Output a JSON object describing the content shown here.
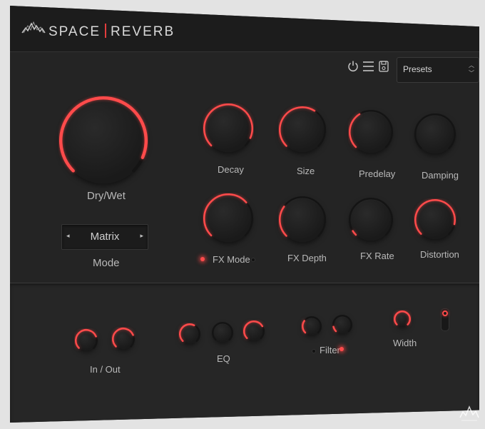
{
  "brand": {
    "left": "SPACE",
    "right": "REVERB",
    "logo_icon": "waveform-logo-icon"
  },
  "toolbar": {
    "power_icon": "power-icon",
    "menu_icon": "menu-icon",
    "save_icon": "save-icon",
    "presets_label": "Presets",
    "presets_arrow_up": "^",
    "presets_arrow_down": "v"
  },
  "colors": {
    "accent": "#ff4b4b",
    "panel": "#242424",
    "header": "#1c1c1c"
  },
  "main_knobs": {
    "dry_wet": {
      "label": "Dry/Wet",
      "value": 0.92
    },
    "decay": {
      "label": "Decay",
      "value": 0.92
    },
    "size": {
      "label": "Size",
      "value": 0.62
    },
    "predelay": {
      "label": "Predelay",
      "value": 0.38
    },
    "damping": {
      "label": "Damping",
      "value": 0.0
    },
    "fx_mode": {
      "label": "FX Mode",
      "value": 0.68
    },
    "fx_depth": {
      "label": "FX Depth",
      "value": 0.3
    },
    "fx_rate": {
      "label": "FX Rate",
      "value": 0.05
    },
    "distortion": {
      "label": "Distortion",
      "value": 0.88
    }
  },
  "mode": {
    "label": "Mode",
    "value": "Matrix",
    "prev": "◂",
    "next": "▸"
  },
  "fx_mode_leds": {
    "left": true,
    "right": false
  },
  "bottom": {
    "in_out": {
      "label": "In / Out",
      "knobs": [
        0.75,
        0.75
      ]
    },
    "eq": {
      "label": "EQ",
      "knobs": [
        0.6,
        0.0,
        0.72
      ]
    },
    "filter": {
      "label": "Filter",
      "knobs": [
        0.3,
        0.12
      ],
      "leds": {
        "left": false,
        "right": true
      }
    },
    "width": {
      "label": "Width",
      "value": 1.0
    },
    "switch_on": true
  }
}
